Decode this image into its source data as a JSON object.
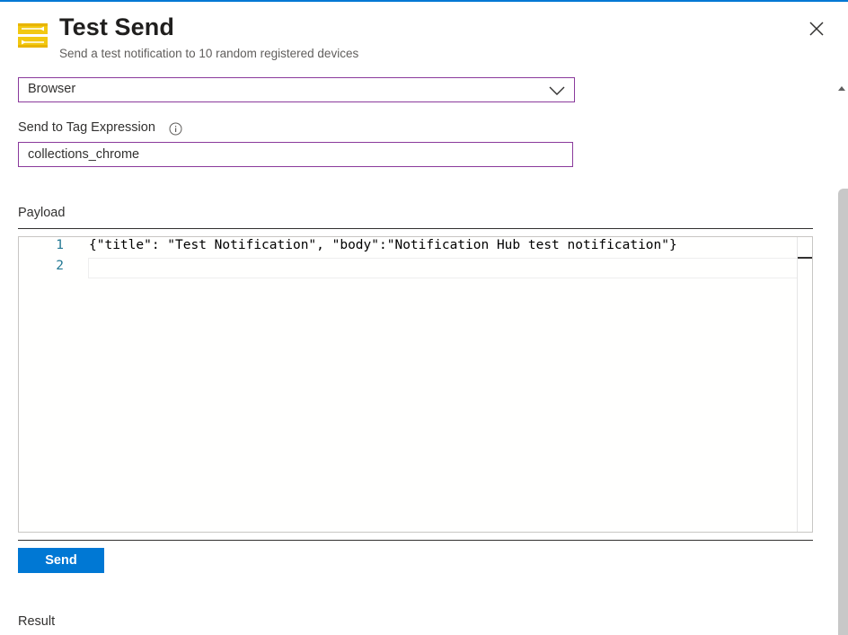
{
  "header": {
    "title": "Test Send",
    "subtitle": "Send a test notification to 10 random registered devices",
    "icon": "notification-hub-icon",
    "close_icon": "close-icon"
  },
  "platform_select": {
    "selected": "Browser",
    "icon": "chevron-down-icon"
  },
  "tag_expression": {
    "label": "Send to Tag Expression",
    "info_icon": "info-icon",
    "value": "collections_chrome"
  },
  "payload": {
    "label": "Payload",
    "lines": [
      {
        "number": "1",
        "text": "{\"title\": \"Test Notification\", \"body\":\"Notification Hub test notification\"}"
      },
      {
        "number": "2",
        "text": ""
      }
    ]
  },
  "actions": {
    "send_label": "Send"
  },
  "result": {
    "label": "Result"
  },
  "colors": {
    "accent": "#0078d4",
    "input_border": "#8a3a9c",
    "line_number": "#237893",
    "icon_yellow": "#f2c811"
  }
}
